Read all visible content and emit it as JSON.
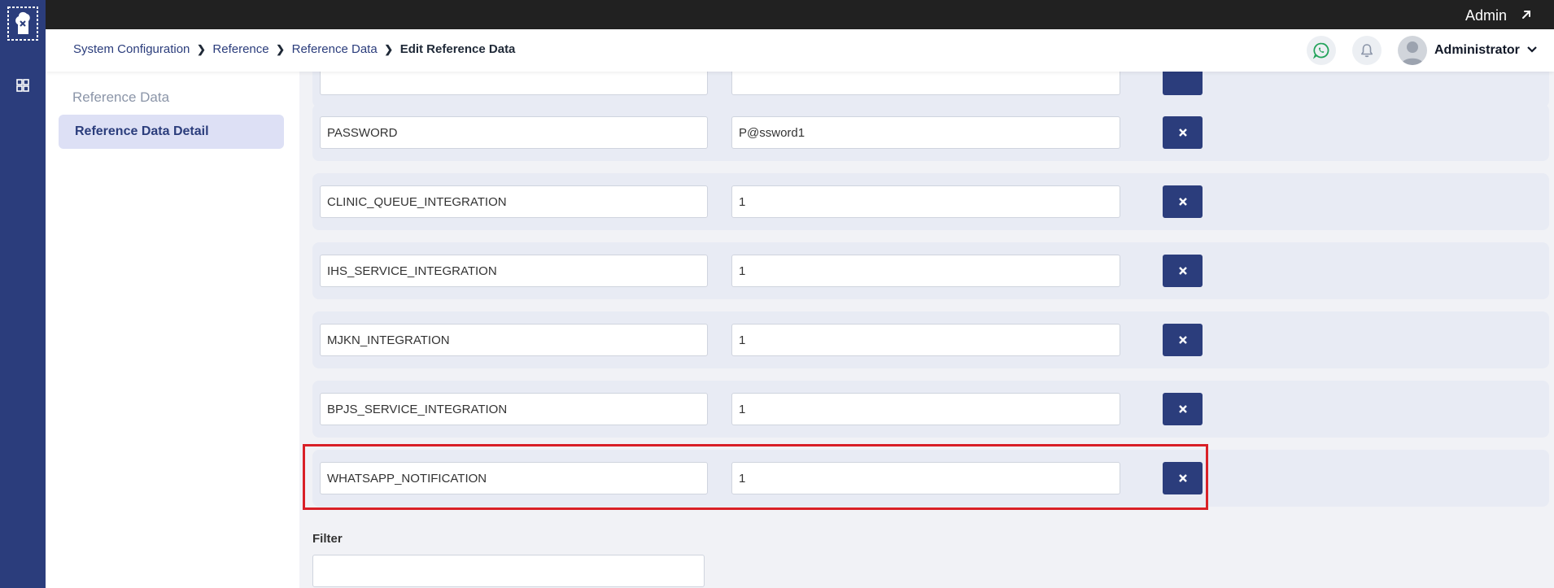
{
  "topbar": {
    "user_label": "Admin"
  },
  "breadcrumb": [
    "System Configuration",
    "Reference",
    "Reference Data",
    "Edit Reference Data"
  ],
  "header": {
    "user_name": "Administrator"
  },
  "sidebar": {
    "title": "Reference Data",
    "items": [
      {
        "label": "Reference Data Detail",
        "active": true
      }
    ]
  },
  "rows": [
    {
      "key": "PASSWORD",
      "value": "P@ssword1"
    },
    {
      "key": "CLINIC_QUEUE_INTEGRATION",
      "value": "1"
    },
    {
      "key": "IHS_SERVICE_INTEGRATION",
      "value": "1"
    },
    {
      "key": "MJKN_INTEGRATION",
      "value": "1"
    },
    {
      "key": "BPJS_SERVICE_INTEGRATION",
      "value": "1"
    },
    {
      "key": "WHATSAPP_NOTIFICATION",
      "value": "1",
      "highlighted": true
    }
  ],
  "filter": {
    "label": "Filter",
    "value": ""
  },
  "colors": {
    "rail": "#2b3d7c",
    "topbar": "#212121",
    "accent": "#2b3d7c",
    "highlight": "#d92027",
    "menu_active_bg": "#dde0f5",
    "whatsapp": "#22a35a"
  },
  "icons": {
    "logo": "app-logo-icon",
    "grid": "grid-icon",
    "external": "external-link-icon",
    "whatsapp": "whatsapp-icon",
    "bell": "bell-icon",
    "chevron": "chevron-down-icon",
    "delete": "close-icon"
  }
}
